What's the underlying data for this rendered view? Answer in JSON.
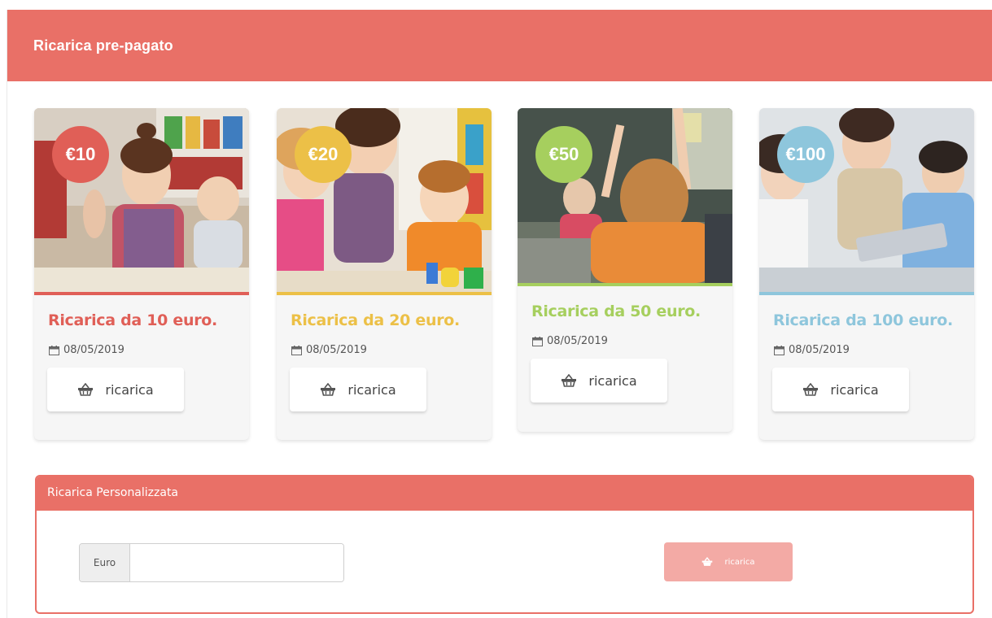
{
  "header": {
    "title": "Ricarica pre-pagato"
  },
  "colors": {
    "header": "#e97067",
    "red": "#e05f57",
    "yellow": "#ecc047",
    "green": "#a6cf5e",
    "blue": "#8ec6dc"
  },
  "cards": [
    {
      "badge": "€10",
      "title": "Ricarica da 10 euro.",
      "date": "08/05/2019",
      "button": "ricarica",
      "icon": "basket-icon"
    },
    {
      "badge": "€20",
      "title": "Ricarica da 20 euro.",
      "date": "08/05/2019",
      "button": "ricarica",
      "icon": "basket-icon"
    },
    {
      "badge": "€50",
      "title": "Ricarica da 50 euro.",
      "date": "08/05/2019",
      "button": "ricarica",
      "icon": "basket-icon"
    },
    {
      "badge": "€100",
      "title": "Ricarica da 100 euro.",
      "date": "08/05/2019",
      "button": "ricarica",
      "icon": "basket-icon"
    }
  ],
  "custom": {
    "title": "Ricarica Personalizzata",
    "addon": "Euro",
    "input_value": "",
    "button": "ricarica"
  }
}
